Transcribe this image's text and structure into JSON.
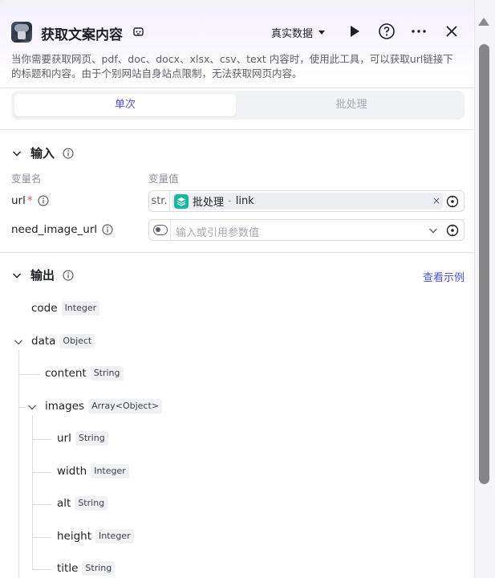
{
  "header": {
    "title": "获取文案内容",
    "data_select": "真实数据",
    "description": "当你需要获取网页、pdf、doc、docx、xlsx、csv、text 内容时，使用此工具，可以获取url链接下的标题和内容。由于个别网站自身站点限制，无法获取网页内容。"
  },
  "tabs": [
    {
      "label": "单次",
      "active": true
    },
    {
      "label": "批处理",
      "active": false
    }
  ],
  "input": {
    "title": "输入",
    "col_name": "变量名",
    "col_value": "变量值",
    "params": [
      {
        "name": "url",
        "required": "*",
        "type_tag": "str.",
        "ref_source": "批处理",
        "ref_sep": "-",
        "ref_field": "link",
        "clear": "×"
      },
      {
        "name": "need_image_url",
        "placeholder": "输入或引用参数值"
      }
    ]
  },
  "output": {
    "title": "输出",
    "example_link": "查看示例",
    "fields": [
      {
        "name": "code",
        "type": "Integer"
      },
      {
        "name": "data",
        "type": "Object"
      },
      {
        "name": "content",
        "type": "String"
      },
      {
        "name": "images",
        "type": "Array<Object>"
      },
      {
        "name": "url",
        "type": "String"
      },
      {
        "name": "width",
        "type": "Integer"
      },
      {
        "name": "alt",
        "type": "String"
      },
      {
        "name": "height",
        "type": "Integer"
      },
      {
        "name": "title",
        "type": "String"
      }
    ]
  },
  "colors": {
    "accent": "#4d53e8",
    "ref_icon": "#19b6a0",
    "required": "#f04a4a"
  },
  "icons": [
    "copy-icon",
    "chevron-down-icon",
    "play-icon",
    "help-icon",
    "more-icon",
    "close-icon",
    "info-icon",
    "layers-icon",
    "variable-icon",
    "toggle-icon"
  ]
}
